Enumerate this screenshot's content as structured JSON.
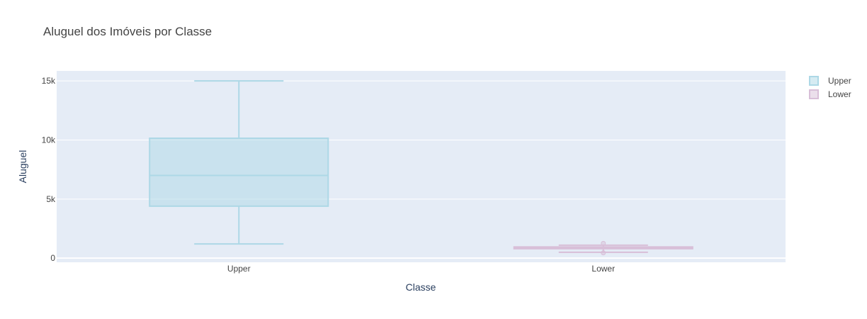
{
  "chart_data": {
    "type": "box",
    "title": "Aluguel dos Imóveis por Classe",
    "xlabel": "Classe",
    "ylabel": "Aluguel",
    "ylim": [
      -350,
      15850
    ],
    "yticks": [
      0,
      5000,
      10000,
      15000
    ],
    "ytick_labels": [
      "0",
      "5k",
      "10k",
      "15k"
    ],
    "grid": true,
    "legend_position": "top-right",
    "categories": [
      "Upper",
      "Lower"
    ],
    "series": [
      {
        "name": "Upper",
        "color": "#add8e6",
        "min": 1200,
        "q1": 4400,
        "median": 7000,
        "q3": 10150,
        "max": 15000,
        "outliers": []
      },
      {
        "name": "Lower",
        "color": "#d8bfd8",
        "min": 500,
        "q1": 800,
        "median": 850,
        "q3": 950,
        "max": 1100,
        "outliers": [
          1250,
          450
        ]
      }
    ]
  }
}
